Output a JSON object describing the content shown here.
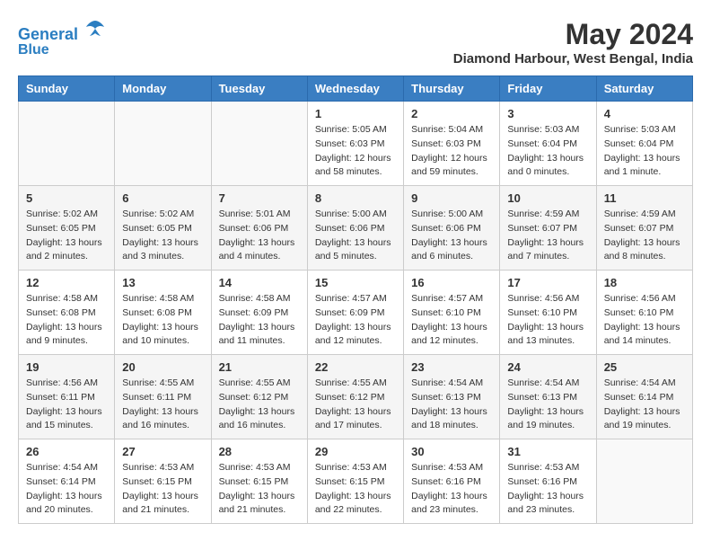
{
  "header": {
    "logo_line1": "General",
    "logo_line2": "Blue",
    "title": "May 2024",
    "location": "Diamond Harbour, West Bengal, India"
  },
  "weekdays": [
    "Sunday",
    "Monday",
    "Tuesday",
    "Wednesday",
    "Thursday",
    "Friday",
    "Saturday"
  ],
  "weeks": [
    [
      {
        "day": "",
        "info": ""
      },
      {
        "day": "",
        "info": ""
      },
      {
        "day": "",
        "info": ""
      },
      {
        "day": "1",
        "info": "Sunrise: 5:05 AM\nSunset: 6:03 PM\nDaylight: 12 hours\nand 58 minutes."
      },
      {
        "day": "2",
        "info": "Sunrise: 5:04 AM\nSunset: 6:03 PM\nDaylight: 12 hours\nand 59 minutes."
      },
      {
        "day": "3",
        "info": "Sunrise: 5:03 AM\nSunset: 6:04 PM\nDaylight: 13 hours\nand 0 minutes."
      },
      {
        "day": "4",
        "info": "Sunrise: 5:03 AM\nSunset: 6:04 PM\nDaylight: 13 hours\nand 1 minute."
      }
    ],
    [
      {
        "day": "5",
        "info": "Sunrise: 5:02 AM\nSunset: 6:05 PM\nDaylight: 13 hours\nand 2 minutes."
      },
      {
        "day": "6",
        "info": "Sunrise: 5:02 AM\nSunset: 6:05 PM\nDaylight: 13 hours\nand 3 minutes."
      },
      {
        "day": "7",
        "info": "Sunrise: 5:01 AM\nSunset: 6:06 PM\nDaylight: 13 hours\nand 4 minutes."
      },
      {
        "day": "8",
        "info": "Sunrise: 5:00 AM\nSunset: 6:06 PM\nDaylight: 13 hours\nand 5 minutes."
      },
      {
        "day": "9",
        "info": "Sunrise: 5:00 AM\nSunset: 6:06 PM\nDaylight: 13 hours\nand 6 minutes."
      },
      {
        "day": "10",
        "info": "Sunrise: 4:59 AM\nSunset: 6:07 PM\nDaylight: 13 hours\nand 7 minutes."
      },
      {
        "day": "11",
        "info": "Sunrise: 4:59 AM\nSunset: 6:07 PM\nDaylight: 13 hours\nand 8 minutes."
      }
    ],
    [
      {
        "day": "12",
        "info": "Sunrise: 4:58 AM\nSunset: 6:08 PM\nDaylight: 13 hours\nand 9 minutes."
      },
      {
        "day": "13",
        "info": "Sunrise: 4:58 AM\nSunset: 6:08 PM\nDaylight: 13 hours\nand 10 minutes."
      },
      {
        "day": "14",
        "info": "Sunrise: 4:58 AM\nSunset: 6:09 PM\nDaylight: 13 hours\nand 11 minutes."
      },
      {
        "day": "15",
        "info": "Sunrise: 4:57 AM\nSunset: 6:09 PM\nDaylight: 13 hours\nand 12 minutes."
      },
      {
        "day": "16",
        "info": "Sunrise: 4:57 AM\nSunset: 6:10 PM\nDaylight: 13 hours\nand 12 minutes."
      },
      {
        "day": "17",
        "info": "Sunrise: 4:56 AM\nSunset: 6:10 PM\nDaylight: 13 hours\nand 13 minutes."
      },
      {
        "day": "18",
        "info": "Sunrise: 4:56 AM\nSunset: 6:10 PM\nDaylight: 13 hours\nand 14 minutes."
      }
    ],
    [
      {
        "day": "19",
        "info": "Sunrise: 4:56 AM\nSunset: 6:11 PM\nDaylight: 13 hours\nand 15 minutes."
      },
      {
        "day": "20",
        "info": "Sunrise: 4:55 AM\nSunset: 6:11 PM\nDaylight: 13 hours\nand 16 minutes."
      },
      {
        "day": "21",
        "info": "Sunrise: 4:55 AM\nSunset: 6:12 PM\nDaylight: 13 hours\nand 16 minutes."
      },
      {
        "day": "22",
        "info": "Sunrise: 4:55 AM\nSunset: 6:12 PM\nDaylight: 13 hours\nand 17 minutes."
      },
      {
        "day": "23",
        "info": "Sunrise: 4:54 AM\nSunset: 6:13 PM\nDaylight: 13 hours\nand 18 minutes."
      },
      {
        "day": "24",
        "info": "Sunrise: 4:54 AM\nSunset: 6:13 PM\nDaylight: 13 hours\nand 19 minutes."
      },
      {
        "day": "25",
        "info": "Sunrise: 4:54 AM\nSunset: 6:14 PM\nDaylight: 13 hours\nand 19 minutes."
      }
    ],
    [
      {
        "day": "26",
        "info": "Sunrise: 4:54 AM\nSunset: 6:14 PM\nDaylight: 13 hours\nand 20 minutes."
      },
      {
        "day": "27",
        "info": "Sunrise: 4:53 AM\nSunset: 6:15 PM\nDaylight: 13 hours\nand 21 minutes."
      },
      {
        "day": "28",
        "info": "Sunrise: 4:53 AM\nSunset: 6:15 PM\nDaylight: 13 hours\nand 21 minutes."
      },
      {
        "day": "29",
        "info": "Sunrise: 4:53 AM\nSunset: 6:15 PM\nDaylight: 13 hours\nand 22 minutes."
      },
      {
        "day": "30",
        "info": "Sunrise: 4:53 AM\nSunset: 6:16 PM\nDaylight: 13 hours\nand 23 minutes."
      },
      {
        "day": "31",
        "info": "Sunrise: 4:53 AM\nSunset: 6:16 PM\nDaylight: 13 hours\nand 23 minutes."
      },
      {
        "day": "",
        "info": ""
      }
    ]
  ]
}
